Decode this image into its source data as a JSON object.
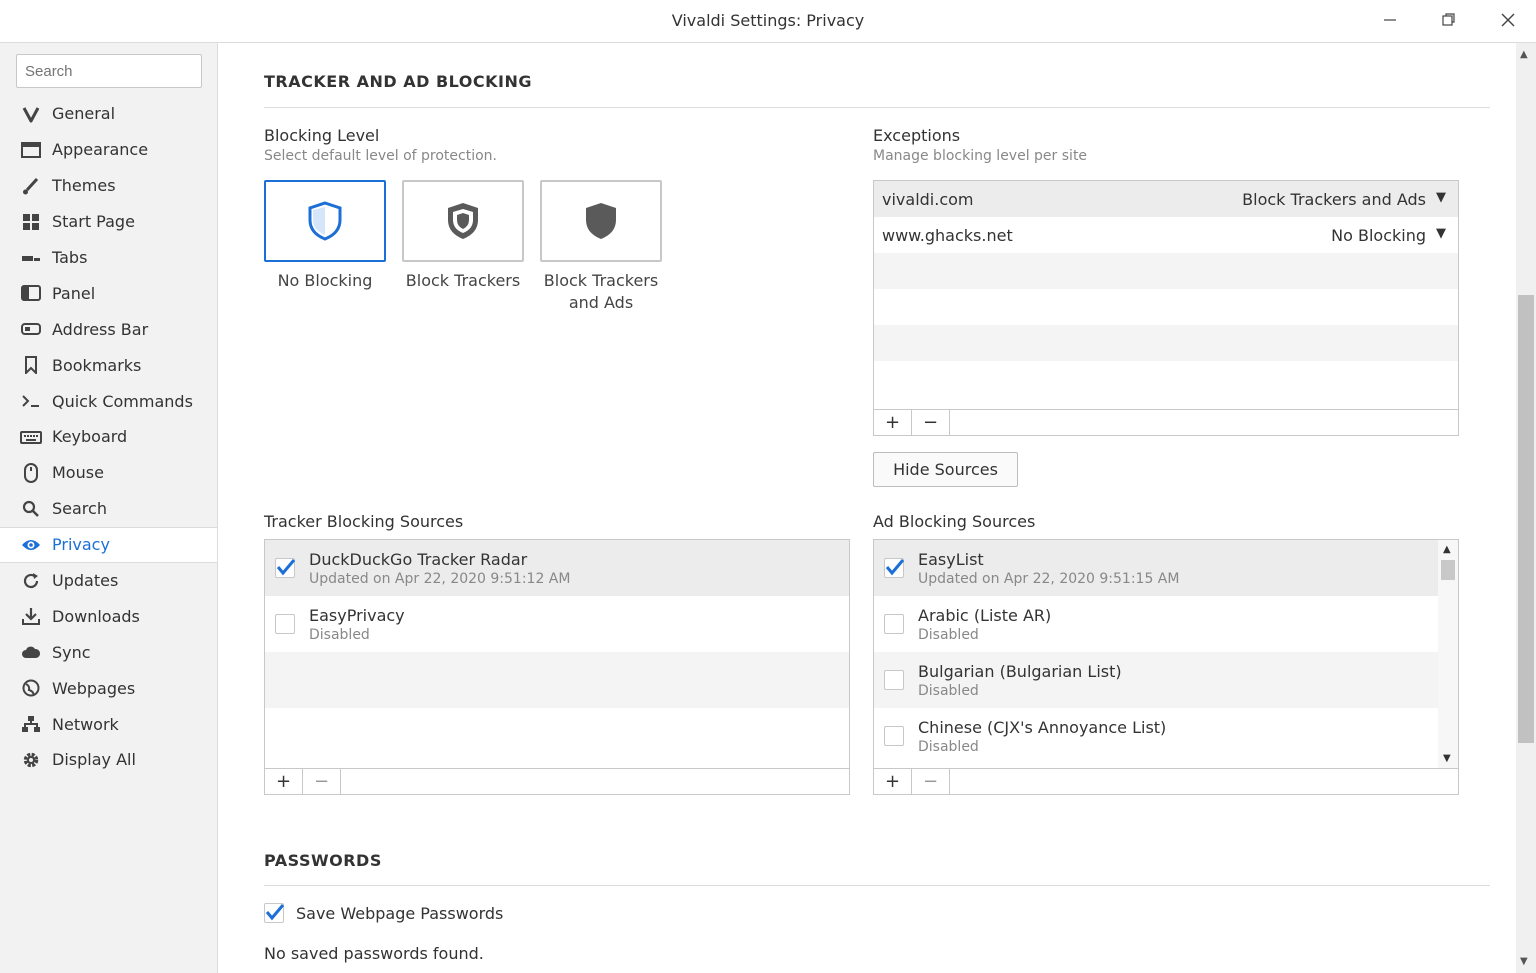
{
  "window": {
    "title": "Vivaldi Settings: Privacy"
  },
  "search": {
    "placeholder": "Search"
  },
  "sidebar": {
    "items": [
      {
        "label": "General",
        "icon": "vivaldi-icon"
      },
      {
        "label": "Appearance",
        "icon": "window-icon"
      },
      {
        "label": "Themes",
        "icon": "brush-icon"
      },
      {
        "label": "Start Page",
        "icon": "grid-icon"
      },
      {
        "label": "Tabs",
        "icon": "tabs-icon"
      },
      {
        "label": "Panel",
        "icon": "panel-icon"
      },
      {
        "label": "Address Bar",
        "icon": "address-bar-icon"
      },
      {
        "label": "Bookmarks",
        "icon": "bookmark-icon"
      },
      {
        "label": "Quick Commands",
        "icon": "quick-commands-icon"
      },
      {
        "label": "Keyboard",
        "icon": "keyboard-icon"
      },
      {
        "label": "Mouse",
        "icon": "mouse-icon"
      },
      {
        "label": "Search",
        "icon": "search-icon"
      },
      {
        "label": "Privacy",
        "icon": "eye-icon",
        "active": true
      },
      {
        "label": "Updates",
        "icon": "refresh-icon"
      },
      {
        "label": "Downloads",
        "icon": "download-icon"
      },
      {
        "label": "Sync",
        "icon": "cloud-icon"
      },
      {
        "label": "Webpages",
        "icon": "globe-icon"
      },
      {
        "label": "Network",
        "icon": "network-icon"
      },
      {
        "label": "Display All",
        "icon": "gear-icon"
      }
    ]
  },
  "tracker": {
    "section_title": "TRACKER AND AD BLOCKING",
    "blocking_level": {
      "title": "Blocking Level",
      "subtitle": "Select default level of protection.",
      "options": [
        {
          "label": "No Blocking",
          "selected": true
        },
        {
          "label": "Block Trackers",
          "selected": false
        },
        {
          "label": "Block Trackers and Ads",
          "selected": false
        }
      ]
    },
    "exceptions": {
      "title": "Exceptions",
      "subtitle": "Manage blocking level per site",
      "rows": [
        {
          "site": "vivaldi.com",
          "level": "Block Trackers and Ads"
        },
        {
          "site": "www.ghacks.net",
          "level": "No Blocking"
        }
      ],
      "add_label": "+",
      "remove_label": "−"
    },
    "hide_sources_label": "Hide Sources",
    "tracker_sources": {
      "title": "Tracker Blocking Sources",
      "items": [
        {
          "name": "DuckDuckGo Tracker Radar",
          "status": "Updated on Apr 22, 2020 9:51:12 AM",
          "checked": true
        },
        {
          "name": "EasyPrivacy",
          "status": "Disabled",
          "checked": false
        }
      ],
      "add_label": "+",
      "remove_label": "−"
    },
    "ad_sources": {
      "title": "Ad Blocking Sources",
      "items": [
        {
          "name": "EasyList",
          "status": "Updated on Apr 22, 2020 9:51:15 AM",
          "checked": true
        },
        {
          "name": "Arabic (Liste AR)",
          "status": "Disabled",
          "checked": false
        },
        {
          "name": "Bulgarian (Bulgarian List)",
          "status": "Disabled",
          "checked": false
        },
        {
          "name": "Chinese (CJX's Annoyance List)",
          "status": "Disabled",
          "checked": false
        }
      ],
      "add_label": "+",
      "remove_label": "−"
    }
  },
  "passwords": {
    "section_title": "PASSWORDS",
    "save_label": "Save Webpage Passwords",
    "save_checked": true,
    "empty_text": "No saved passwords found."
  },
  "colors": {
    "accent": "#1c6fd6",
    "shield_dark": "#5a5a5a"
  }
}
